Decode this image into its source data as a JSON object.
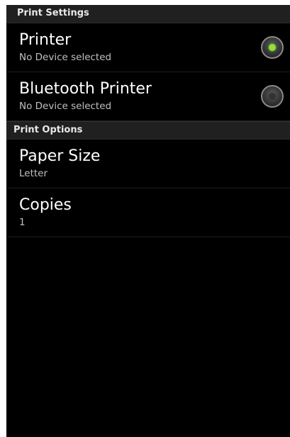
{
  "print_settings": {
    "header": "Print Settings",
    "items": [
      {
        "title": "Printer",
        "summary": "No Device selected",
        "selected": true
      },
      {
        "title": "Bluetooth Printer",
        "summary": "No Device selected",
        "selected": false
      }
    ]
  },
  "print_options": {
    "header": "Print Options",
    "items": [
      {
        "title": "Paper Size",
        "summary": "Letter"
      },
      {
        "title": "Copies",
        "summary": "1"
      }
    ]
  },
  "colors": {
    "background": "#000000",
    "section_header_bg": "#202020",
    "radio_selected": "#8fe03a"
  },
  "icons": {
    "radio_selected": "radio-selected-icon",
    "radio_unselected": "radio-unselected-icon"
  }
}
